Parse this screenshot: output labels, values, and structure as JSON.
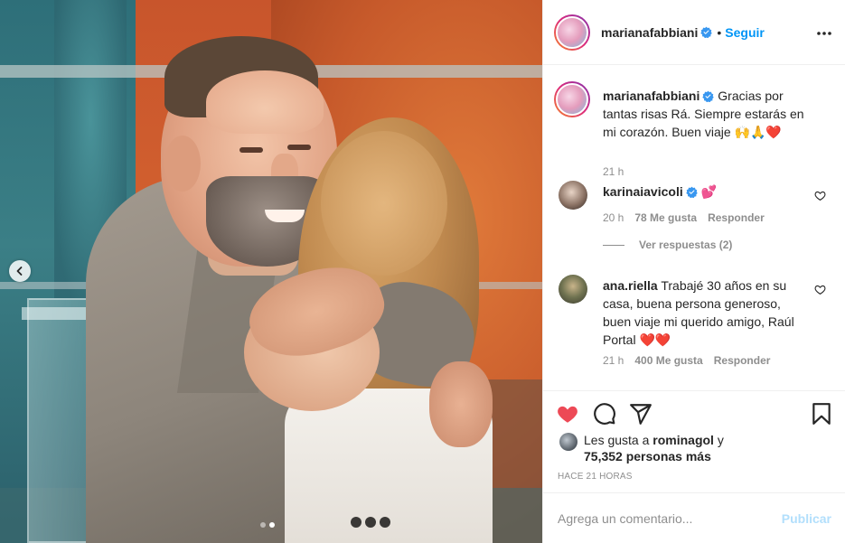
{
  "post": {
    "username": "marianafabbiani",
    "follow_label": "Seguir",
    "separator": "•",
    "menu_icon": "more-horizontal-icon"
  },
  "caption": {
    "username": "marianafabbiani",
    "text": "Gracias por tantas risas Rá. Siempre estarás en mi corazón. Buen viaje",
    "emojis": "🙌🙏❤️",
    "time": "21 h"
  },
  "comments": [
    {
      "username": "karinaiavicoli",
      "text": "",
      "emoji": "💕",
      "time": "20 h",
      "likes": "78 Me gusta",
      "reply_label": "Responder",
      "view_replies": "Ver respuestas (2)"
    },
    {
      "username": "ana.riella",
      "text": "Trabajé 30 años en su casa, buena persona generoso, buen viaje mi querido amigo, Raúl Portal",
      "emoji": "❤️❤️",
      "time": "21 h",
      "likes": "400 Me gusta",
      "reply_label": "Responder"
    }
  ],
  "likes": {
    "prefix": "Les gusta a ",
    "user": "rominagol",
    "mid": " y",
    "count": "75,352 personas más"
  },
  "posted_ago": "HACE 21 HORAS",
  "add_comment": {
    "placeholder": "Agrega un comentario...",
    "publish_label": "Publicar"
  },
  "colors": {
    "accent": "#0095f6",
    "like_red": "#ed4956",
    "muted": "#8e8e8e",
    "publish_disabled": "#b2dffc"
  },
  "carousel": {
    "slide_count": 2,
    "active_index": 1
  }
}
